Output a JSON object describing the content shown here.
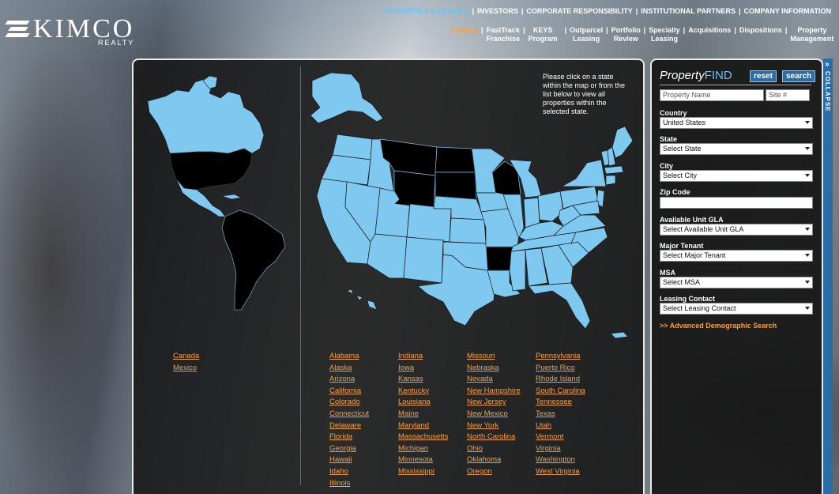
{
  "brand": {
    "name": "KIMCO",
    "sub": "REALTY"
  },
  "topnav": {
    "items": [
      "PROPERTIES & LEASING",
      "INVESTORS",
      "CORPORATE RESPONSIBILITY",
      "INSTITUTIONAL PARTNERS",
      "COMPANY INFORMATION"
    ]
  },
  "subnav": {
    "items": [
      {
        "line1": "Leasing",
        "line2": ""
      },
      {
        "line1": "FastTrack",
        "line2": "Franchise"
      },
      {
        "line1": "KEYS",
        "line2": "Program"
      },
      {
        "line1": "Outparcel",
        "line2": "Leasing"
      },
      {
        "line1": "Portfolio",
        "line2": "Review"
      },
      {
        "line1": "Specialty",
        "line2": "Leasing"
      },
      {
        "line1": "Acquisitions",
        "line2": ""
      },
      {
        "line1": "Dispositions",
        "line2": ""
      },
      {
        "line1": "Property",
        "line2": "Management"
      }
    ]
  },
  "map": {
    "instructions": "Please click on a state within the map or from the list below to view all properties within the selected state.",
    "colors": {
      "available": "#7fc8ef",
      "unavailable": "#000000"
    }
  },
  "countries": [
    "Canada",
    "Mexico"
  ],
  "states": {
    "col1": [
      "Alabama",
      "Alaska",
      "Arizona",
      "California",
      "Colorado",
      "Connecticut",
      "Delaware",
      "Florida",
      "Georgia",
      "Hawaii",
      "Idaho",
      "Illinois"
    ],
    "col2": [
      "Indiana",
      "Iowa",
      "Kansas",
      "Kentucky",
      "Louisiana",
      "Maine",
      "Maryland",
      "Massachusetts",
      "Michigan",
      "Minnesota",
      "Mississippi"
    ],
    "col3": [
      "Missouri",
      "Nebraska",
      "Nevada",
      "New Hampshire",
      "New Jersey",
      "New Mexico",
      "New York",
      "North Carolina",
      "Ohio",
      "Oklahoma",
      "Oregon"
    ],
    "col4": [
      "Pennsylvania",
      "Puerto Rico",
      "Rhode Island",
      "South Carolina",
      "Tennessee",
      "Texas",
      "Utah",
      "Vermont",
      "Virginia",
      "Washington",
      "West Virginia"
    ]
  },
  "search": {
    "title": "Property",
    "title_accent": "FIND",
    "reset_label": "reset",
    "search_label": "search",
    "property_name_placeholder": "Property Name",
    "site_placeholder": "Site #",
    "fields": {
      "country_label": "Country",
      "country_value": "United States",
      "state_label": "State",
      "state_value": "Select State",
      "city_label": "City",
      "city_value": "Select City",
      "zip_label": "Zip Code",
      "gla_label": "Available Unit GLA",
      "gla_value": "Select Available Unit GLA",
      "tenant_label": "Major Tenant",
      "tenant_value": "Select Major Tenant",
      "msa_label": "MSA",
      "msa_value": "Select MSA",
      "contact_label": "Leasing Contact",
      "contact_value": "Select Leasing Contact"
    },
    "advanced_link": ">> Advanced Demographic Search",
    "collapse_label": "COLLAPSE",
    "collapse_chevron": "»"
  }
}
